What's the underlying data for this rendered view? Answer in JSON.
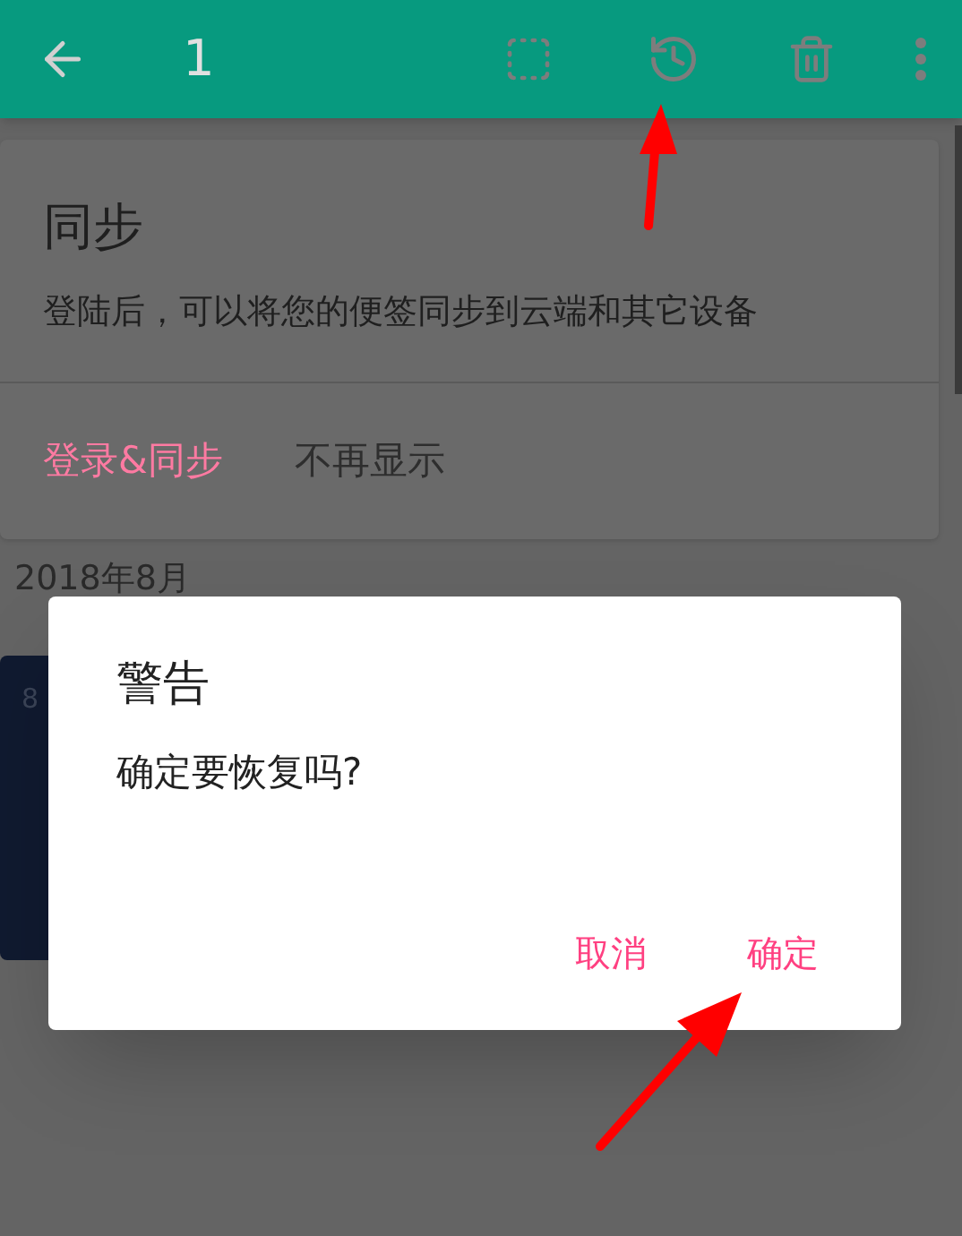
{
  "toolbar": {
    "count": "1"
  },
  "sync_card": {
    "title": "同步",
    "message": "登陆后，可以将您的便签同步到云端和其它设备",
    "buttons": [
      {
        "label": "登录&同步",
        "kind": "primary"
      },
      {
        "label": "不再显示",
        "kind": "secondary"
      }
    ]
  },
  "section_header": "2018年8月",
  "note_card": {
    "text": "8"
  },
  "dialog": {
    "title": "警告",
    "message": "确定要恢复吗?",
    "buttons": [
      "取消",
      "确定"
    ]
  }
}
